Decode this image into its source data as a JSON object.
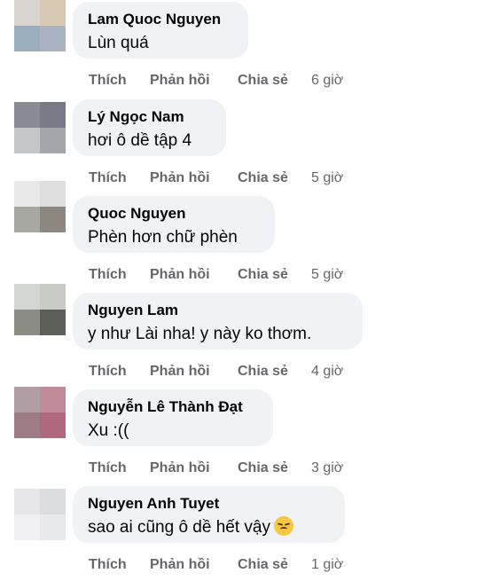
{
  "actions": {
    "like": "Thích",
    "reply": "Phản hồi",
    "share": "Chia sẻ"
  },
  "comments": [
    {
      "author": "Lam Quoc Nguyen",
      "text": "Lùn quá",
      "time": "6 giờ",
      "avatar_colors": [
        "#d9d4cf",
        "#d8c9b3",
        "#9aaebf",
        "#a9b3c2"
      ]
    },
    {
      "author": "Lý Ngọc Nam",
      "text": "hơi ô dề tập 4",
      "time": "5 giờ",
      "avatar_colors": [
        "#8a8a94",
        "#7a7a86",
        "#c4c6ca",
        "#a4a6ac"
      ]
    },
    {
      "author": "Quoc Nguyen",
      "text": "Phèn hơn chữ phèn",
      "time": "5 giờ",
      "avatar_colors": [
        "#e9e9e9",
        "#dedede",
        "#a7a8a0",
        "#8e877f"
      ]
    },
    {
      "author": "Nguyen Lam",
      "text": "y như Lài nha! y này ko thơm.",
      "time": "4 giờ",
      "avatar_colors": [
        "#d3d7d1",
        "#c8ccc4",
        "#8b8c84",
        "#5c5e58"
      ]
    },
    {
      "author": "Nguyễn Lê Thành Đạt",
      "text": "Xu :((",
      "time": "3 giờ",
      "avatar_colors": [
        "#b09ea4",
        "#c08a98",
        "#9e7c86",
        "#b0687c"
      ]
    },
    {
      "author": "Nguyen Anh Tuyet",
      "text": "sao ai cũng ô dề hết vậy",
      "emoji": "disappointed-face",
      "time": "1 giờ",
      "avatar_colors": [
        "#e6e6e8",
        "#dcdde0",
        "#f0f0f2",
        "#e8e9ec"
      ]
    }
  ]
}
